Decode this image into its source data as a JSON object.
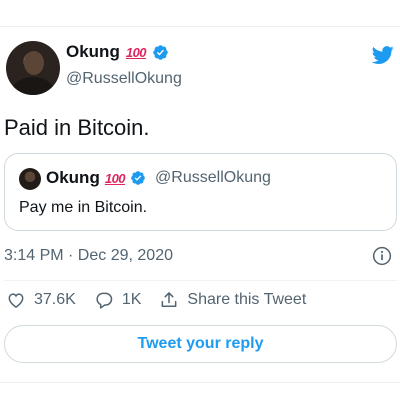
{
  "author": {
    "name": "Okung",
    "emoji": "100",
    "handle": "@RussellOkung"
  },
  "tweet": {
    "text": "Paid in Bitcoin."
  },
  "quoted": {
    "name": "Okung",
    "emoji": "100",
    "handle": "@RussellOkung",
    "text": "Pay me in Bitcoin."
  },
  "meta": {
    "timestamp": "3:14 PM · Dec 29, 2020"
  },
  "actions": {
    "likes": "37.6K",
    "replies": "1K",
    "share_label": "Share this Tweet"
  },
  "reply": {
    "label": "Tweet your reply"
  },
  "colors": {
    "brand": "#1d9bf0",
    "emoji_red": "#e0245e",
    "secondary_text": "#536471"
  },
  "icons": [
    "twitter-bird-icon",
    "verified-badge-icon",
    "info-icon",
    "heart-icon",
    "reply-bubble-icon",
    "share-icon"
  ]
}
